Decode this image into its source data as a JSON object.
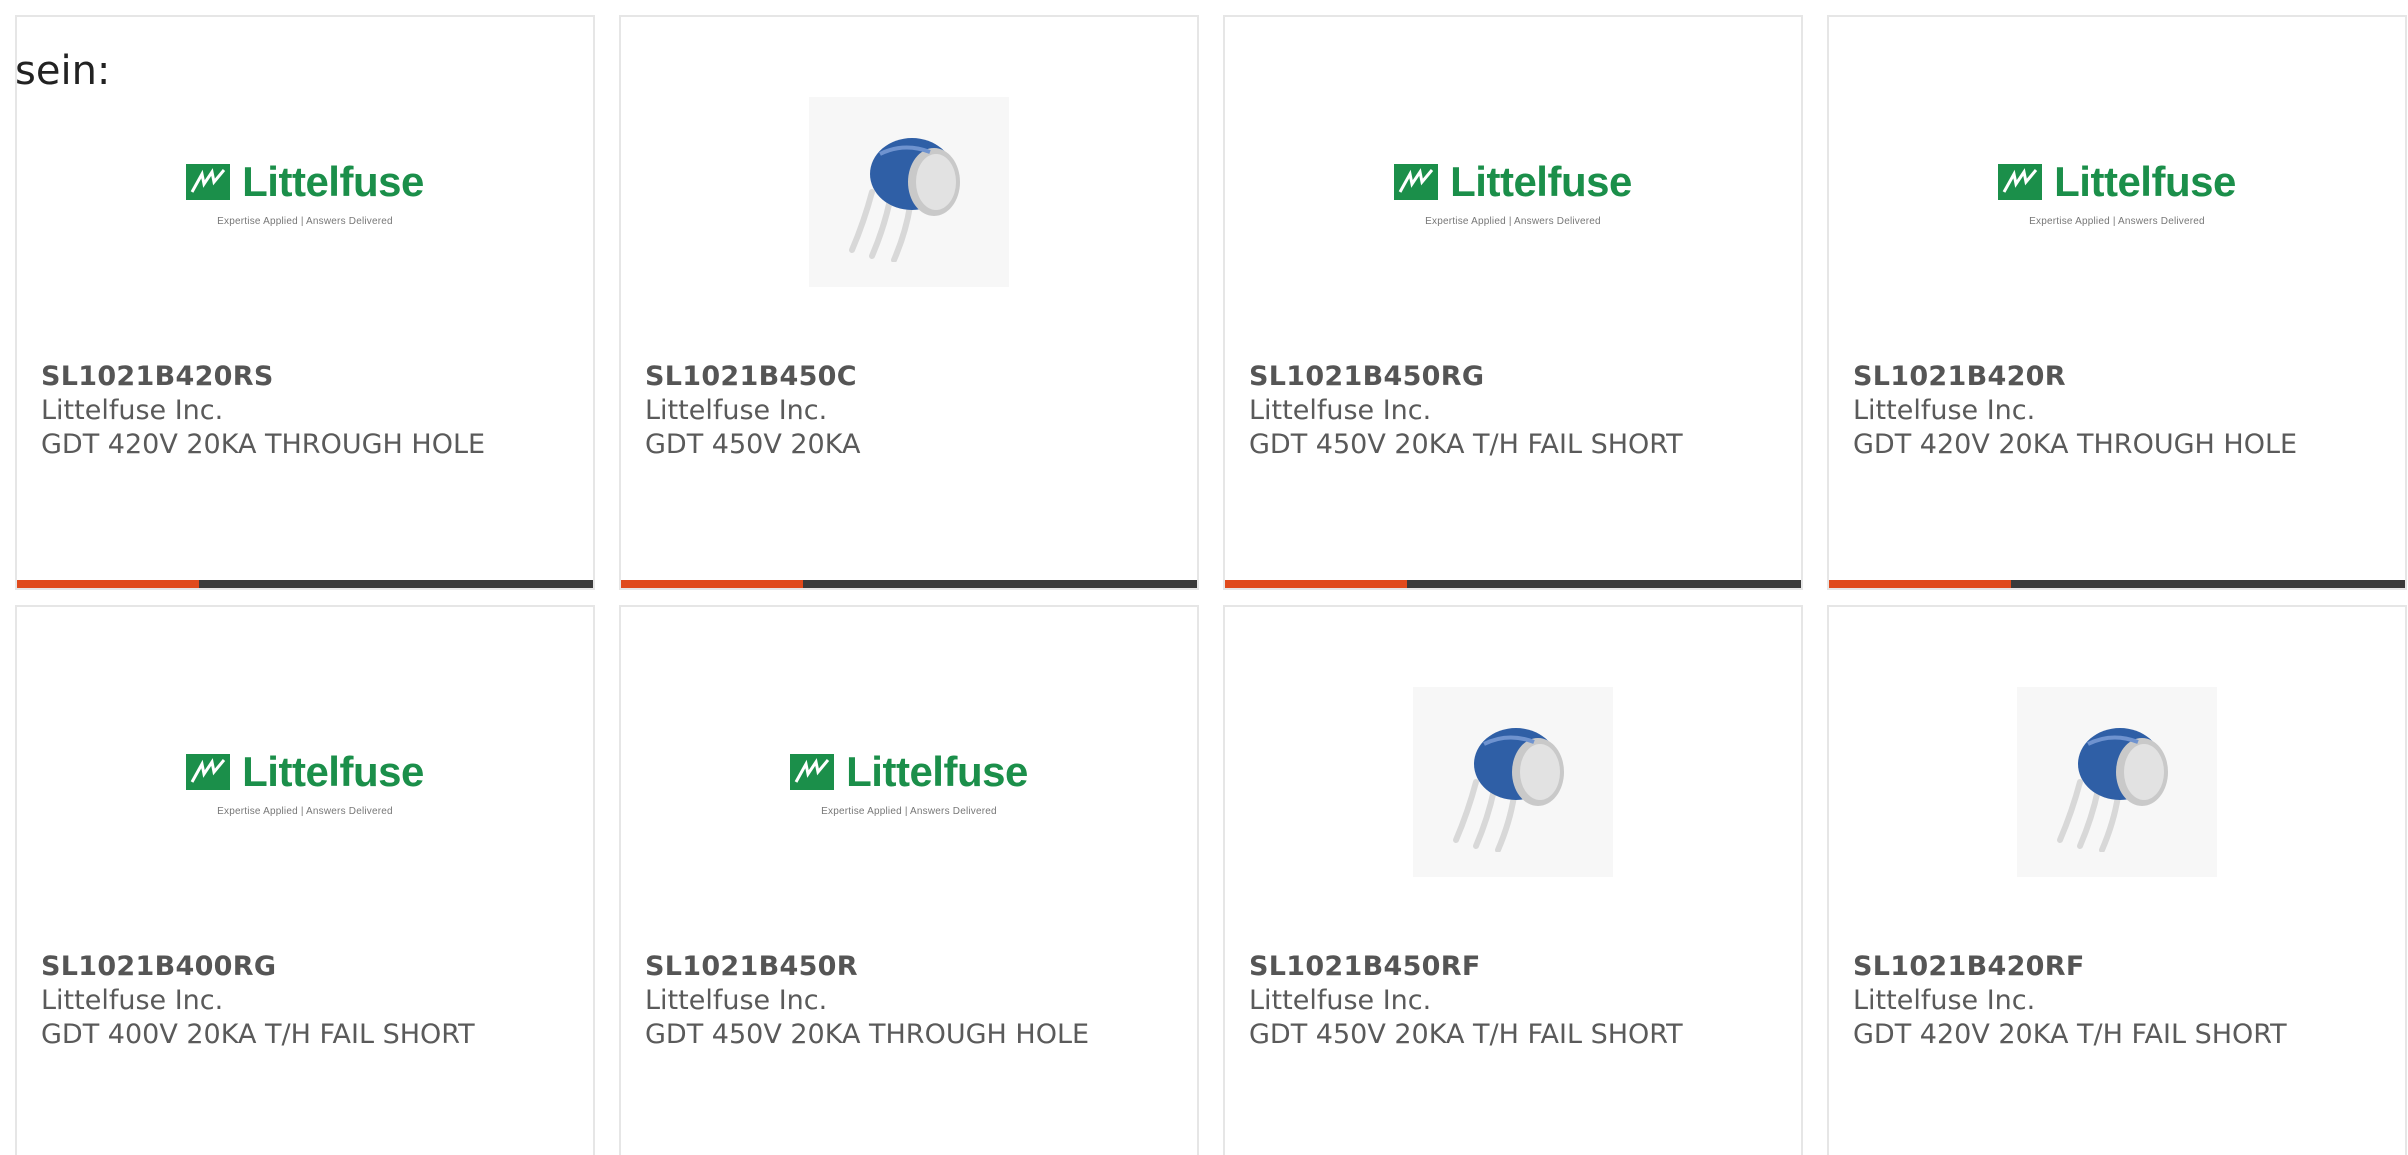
{
  "heading": "sein:",
  "colors": {
    "accent": "#e04a1c",
    "bar_dark": "#3a3a3a",
    "logo_green": "#1b8f4a",
    "component_blue": "#2f5fa6"
  },
  "logo": {
    "word": "Littelfuse",
    "tagline": "Expertise Applied | Answers Delivered"
  },
  "products": [
    {
      "part": "SL1021B420RS",
      "manufacturer": "Littelfuse Inc.",
      "description": "GDT 420V 20KA THROUGH HOLE",
      "image": "littelfuse-logo",
      "has_bar": true
    },
    {
      "part": "SL1021B450C",
      "manufacturer": "Littelfuse Inc.",
      "description": "GDT 450V 20KA",
      "image": "gdt-component-photo",
      "has_bar": true
    },
    {
      "part": "SL1021B450RG",
      "manufacturer": "Littelfuse Inc.",
      "description": "GDT 450V 20KA T/H FAIL SHORT",
      "image": "littelfuse-logo",
      "has_bar": true
    },
    {
      "part": "SL1021B420R",
      "manufacturer": "Littelfuse Inc.",
      "description": "GDT 420V 20KA THROUGH HOLE",
      "image": "littelfuse-logo",
      "has_bar": true
    },
    {
      "part": "SL1021B400RG",
      "manufacturer": "Littelfuse Inc.",
      "description": "GDT 400V 20KA T/H FAIL SHORT",
      "image": "littelfuse-logo",
      "has_bar": false
    },
    {
      "part": "SL1021B450R",
      "manufacturer": "Littelfuse Inc.",
      "description": "GDT 450V 20KA THROUGH HOLE",
      "image": "littelfuse-logo",
      "has_bar": false
    },
    {
      "part": "SL1021B450RF",
      "manufacturer": "Littelfuse Inc.",
      "description": "GDT 450V 20KA T/H FAIL SHORT",
      "image": "gdt-component-photo",
      "has_bar": false
    },
    {
      "part": "SL1021B420RF",
      "manufacturer": "Littelfuse Inc.",
      "description": "GDT 420V 20KA T/H FAIL SHORT",
      "image": "gdt-component-photo",
      "has_bar": false
    }
  ]
}
